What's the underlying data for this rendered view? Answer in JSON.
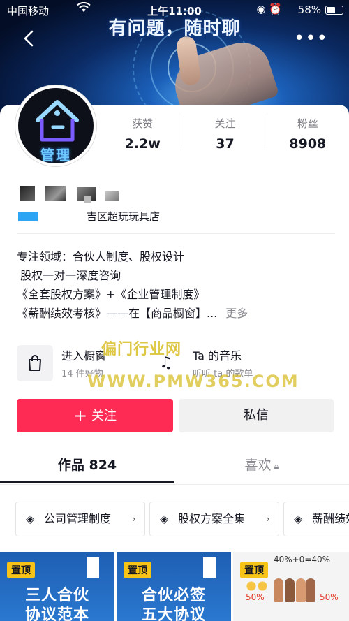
{
  "status_bar": {
    "carrier": "中国移动",
    "time": "上午11:00",
    "battery": "58%",
    "battery_level": 0.58
  },
  "banner": {
    "title": "有问题，随时聊"
  },
  "profile": {
    "avatar_text": "管理",
    "stats": [
      {
        "label": "获赞",
        "value": "2.2w"
      },
      {
        "label": "关注",
        "value": "37"
      },
      {
        "label": "粉丝",
        "value": "8908"
      }
    ],
    "shop_name": "吉区超玩玩具店",
    "bio_lines": [
      "专注领域：合伙人制度、股权设计",
      " 股权一对一深度咨询",
      "《全套股权方案》+《企业管理制度》",
      "《薪酬绩效考核》——在【商品橱窗】..."
    ],
    "bio_more": "更多"
  },
  "features": {
    "window": {
      "title": "进入橱窗",
      "subtitle": "14 件好物",
      "icon": "shopping-bag-icon"
    },
    "music": {
      "title": "Ta 的音乐",
      "subtitle": "听听 ta 的歌单",
      "icon": "music-note-icon"
    }
  },
  "watermark": {
    "line1": "偏门行业网",
    "line2": "WWW.PMW365.COM"
  },
  "actions": {
    "follow": "关注",
    "message": "私信"
  },
  "tabs": {
    "works": "作品 824",
    "likes": "喜欢"
  },
  "collections": [
    {
      "label": "公司管理制度"
    },
    {
      "label": "股权方案全集"
    },
    {
      "label": "薪酬绩效"
    }
  ],
  "videos": [
    {
      "pin": "置顶",
      "line1": "三人合伙",
      "line2": "协议范本"
    },
    {
      "pin": "置顶",
      "line1": "合伙必签",
      "line2": "五大协议"
    },
    {
      "pin": "置顶",
      "formula": "40%+0=40%",
      "pct1": "50%",
      "pct2": "50%"
    }
  ],
  "colors": {
    "follow_button": "#fe2c55",
    "message_button": "#f1f1f2",
    "pin_badge": "#f7c317",
    "tile_blue": "#2a78d0"
  }
}
